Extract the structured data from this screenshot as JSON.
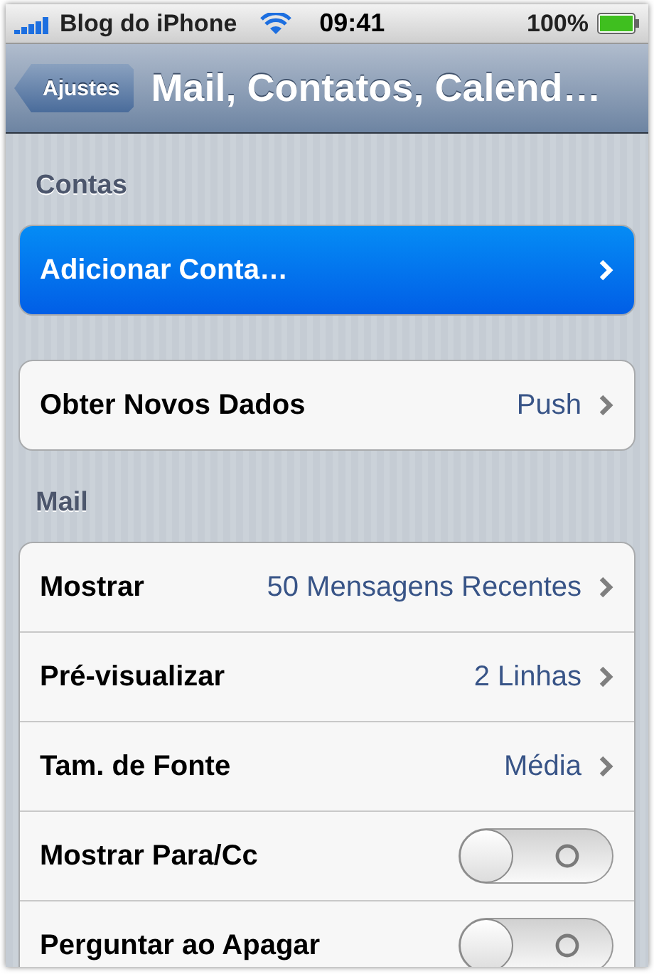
{
  "status_bar": {
    "carrier": "Blog do iPhone",
    "time": "09:41",
    "battery": "100%"
  },
  "nav_bar": {
    "back": "Ajustes",
    "title": "Mail, Contatos, Calend…"
  },
  "sections": [
    {
      "header": "Contas",
      "rows": [
        {
          "kind": "link",
          "label": "Adicionar Conta…",
          "selected": true
        }
      ]
    },
    {
      "rows": [
        {
          "kind": "link",
          "label": "Obter Novos Dados",
          "value": "Push",
          "selected": false
        }
      ]
    },
    {
      "header": "Mail",
      "rows": [
        {
          "kind": "link",
          "label": "Mostrar",
          "value": "50 Mensagens Recentes",
          "selected": false
        },
        {
          "kind": "link",
          "label": "Pré-visualizar",
          "value": "2 Linhas",
          "selected": false
        },
        {
          "kind": "link",
          "label": "Tam. de Fonte",
          "value": "Média",
          "selected": false
        },
        {
          "kind": "toggle",
          "label": "Mostrar Para/Cc",
          "on": false
        },
        {
          "kind": "toggle",
          "label": "Perguntar ao Apagar",
          "on": false
        }
      ]
    }
  ]
}
